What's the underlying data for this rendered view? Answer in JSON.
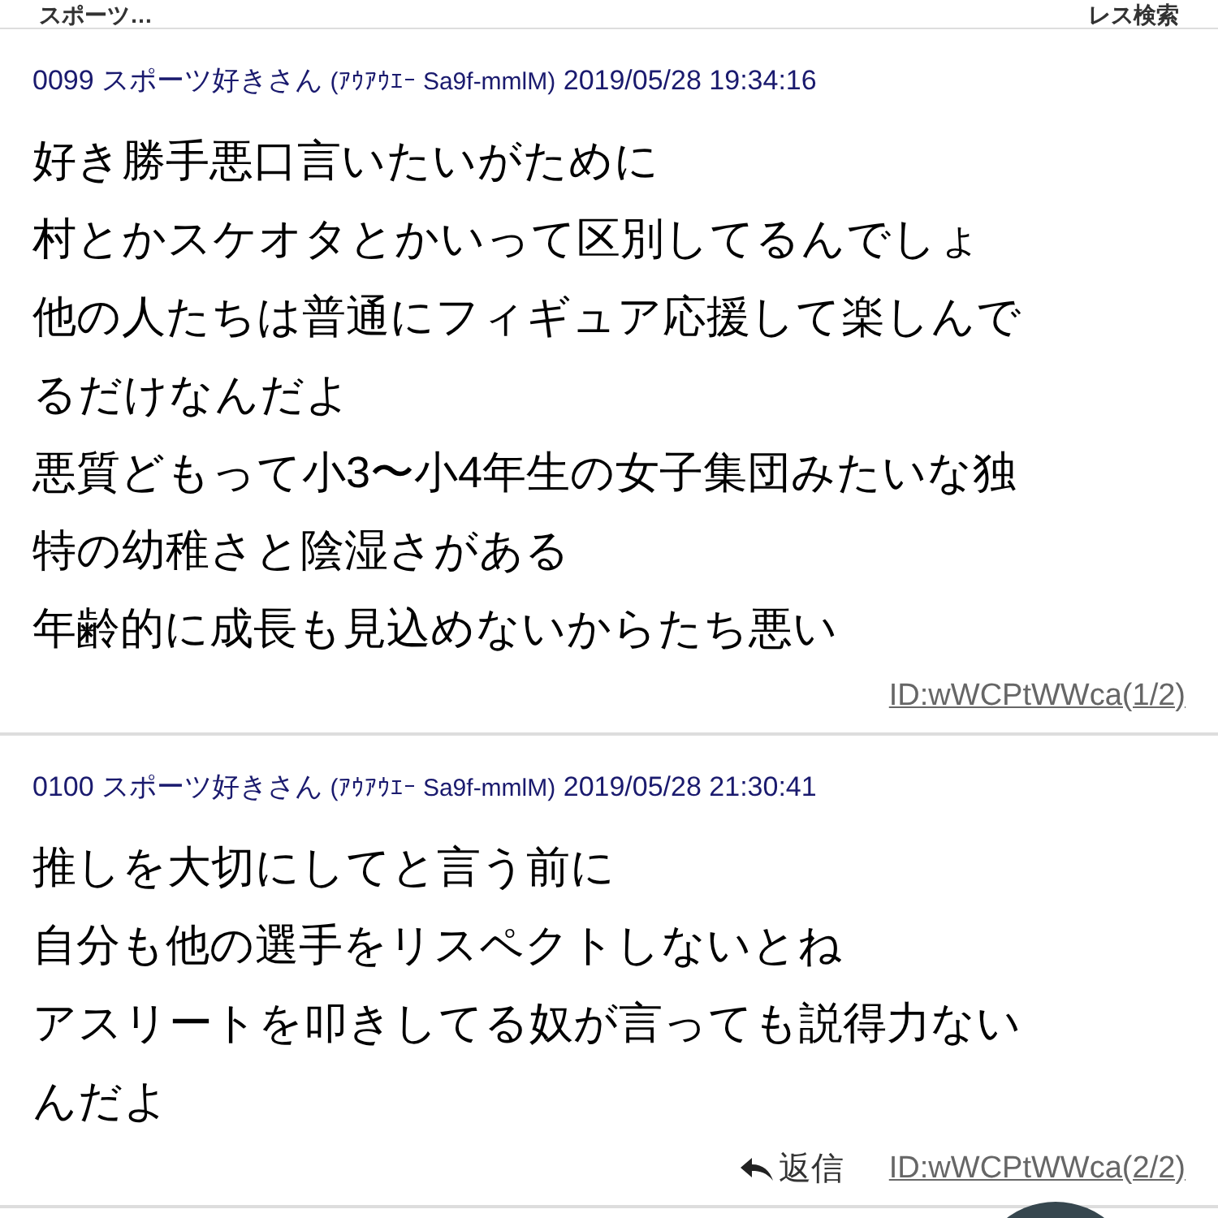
{
  "header": {
    "title": "スポーツ…",
    "search": "レス検索"
  },
  "posts": [
    {
      "number": "0099",
      "name": "スポーツ好きさん",
      "tag": "(ｱｳｱｳｴｰ Sa9f-mmlM)",
      "date": "2019/05/28 19:34:16",
      "lines": [
        "好き勝手悪口言いたいがために",
        "村とかスケオタとかいって区別してるんでしょ",
        "他の人たちは普通にフィギュア応援して楽しんで",
        "るだけなんだよ",
        "悪質どもって小3〜小4年生の女子集団みたいな独",
        "特の幼稚さと陰湿さがある",
        "年齢的に成長も見込めないからたち悪い"
      ],
      "id": "ID:wWCPtWWca(1/2)"
    },
    {
      "number": "0100",
      "name": "スポーツ好きさん",
      "tag": "(ｱｳｱｳｴｰ Sa9f-mmlM)",
      "date": "2019/05/28 21:30:41",
      "lines": [
        "推しを大切にしてと言う前に",
        "自分も他の選手をリスペクトしないとね",
        "アスリートを叩きしてる奴が言っても説得力ない",
        "んだよ"
      ],
      "reply": "返信",
      "id": "ID:wWCPtWWca(2/2)"
    }
  ]
}
